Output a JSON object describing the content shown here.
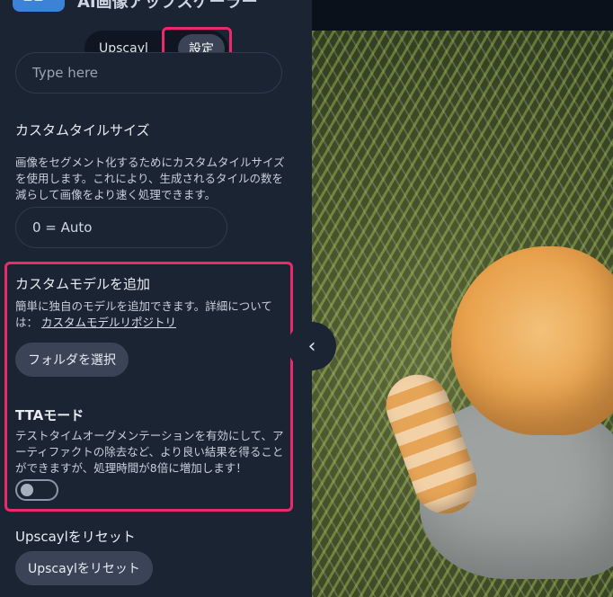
{
  "header": {
    "app_title": "AI画像アップスケーラー"
  },
  "segmented": {
    "tabs": [
      "Upscayl",
      "設定"
    ],
    "active_index": 1
  },
  "partial_input": {
    "placeholder": "Type here"
  },
  "custom_tile": {
    "title": "カスタムタイルサイズ",
    "description": "画像をセグメント化するためにカスタムタイルサイズを使用します。これにより、生成されるタイルの数を減らして画像をより速く処理できます。",
    "value": "0 = Auto"
  },
  "custom_model": {
    "title": "カスタムモデルを追加",
    "description_prefix": "簡単に独自のモデルを追加できます。詳細については：",
    "link_text": "カスタムモデルリポジトリ",
    "button": "フォルダを選択"
  },
  "tta": {
    "title": "TTAモード",
    "description": "テストタイムオーグメンテーションを有効にして、アーティファクトの除去など、より良い結果を得ることができますが、処理時間が8倍に増加します！",
    "enabled": false
  },
  "reset": {
    "title": "Upscaylをリセット",
    "button": "Upscaylをリセット"
  },
  "highlight": {
    "color": "#ea2a6a"
  },
  "icons": {
    "collapse": "chevron-left-icon",
    "logo": "app-logo-icon"
  }
}
